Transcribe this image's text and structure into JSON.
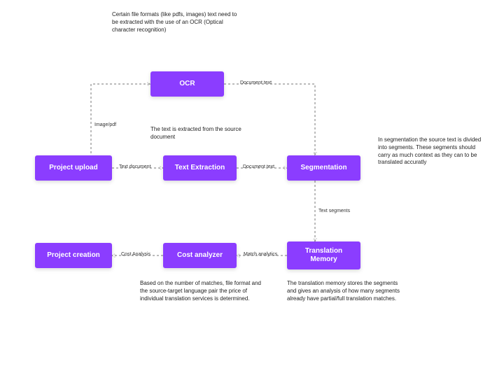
{
  "nodes": {
    "project_upload": "Project upload",
    "ocr": "OCR",
    "text_extraction": "Text Extraction",
    "segmentation": "Segmentation",
    "translation_memory": "Translation Memory",
    "cost_analyzer": "Cost analyzer",
    "project_creation": "Project creation"
  },
  "edges": {
    "image_pdf": "Image/pdf",
    "text_document": "Text document",
    "ocr_out": "Document text",
    "extraction_out": "Document text",
    "seg_out": "Text segments",
    "tm_out": "Match analytics",
    "cost_out": "Cost Analysis"
  },
  "descriptions": {
    "ocr": "Certain file formats (like pdfs, images) text need to be extracted with the use of an OCR (Optical character recognition)",
    "extraction": "The text is extracted from the source document",
    "segmentation": "In segmentation the source text is divided into segments. These segments should carry as much context as they can to be translated accuratly",
    "tm": "The translation memory stores the segments and gives an analysis of how many segments already have partial/full translation matches.",
    "cost": "Based on the number of matches, file format and the source-target language pair the price of individual translation services is determined."
  },
  "colors": {
    "node_bg": "#8b3dff"
  }
}
